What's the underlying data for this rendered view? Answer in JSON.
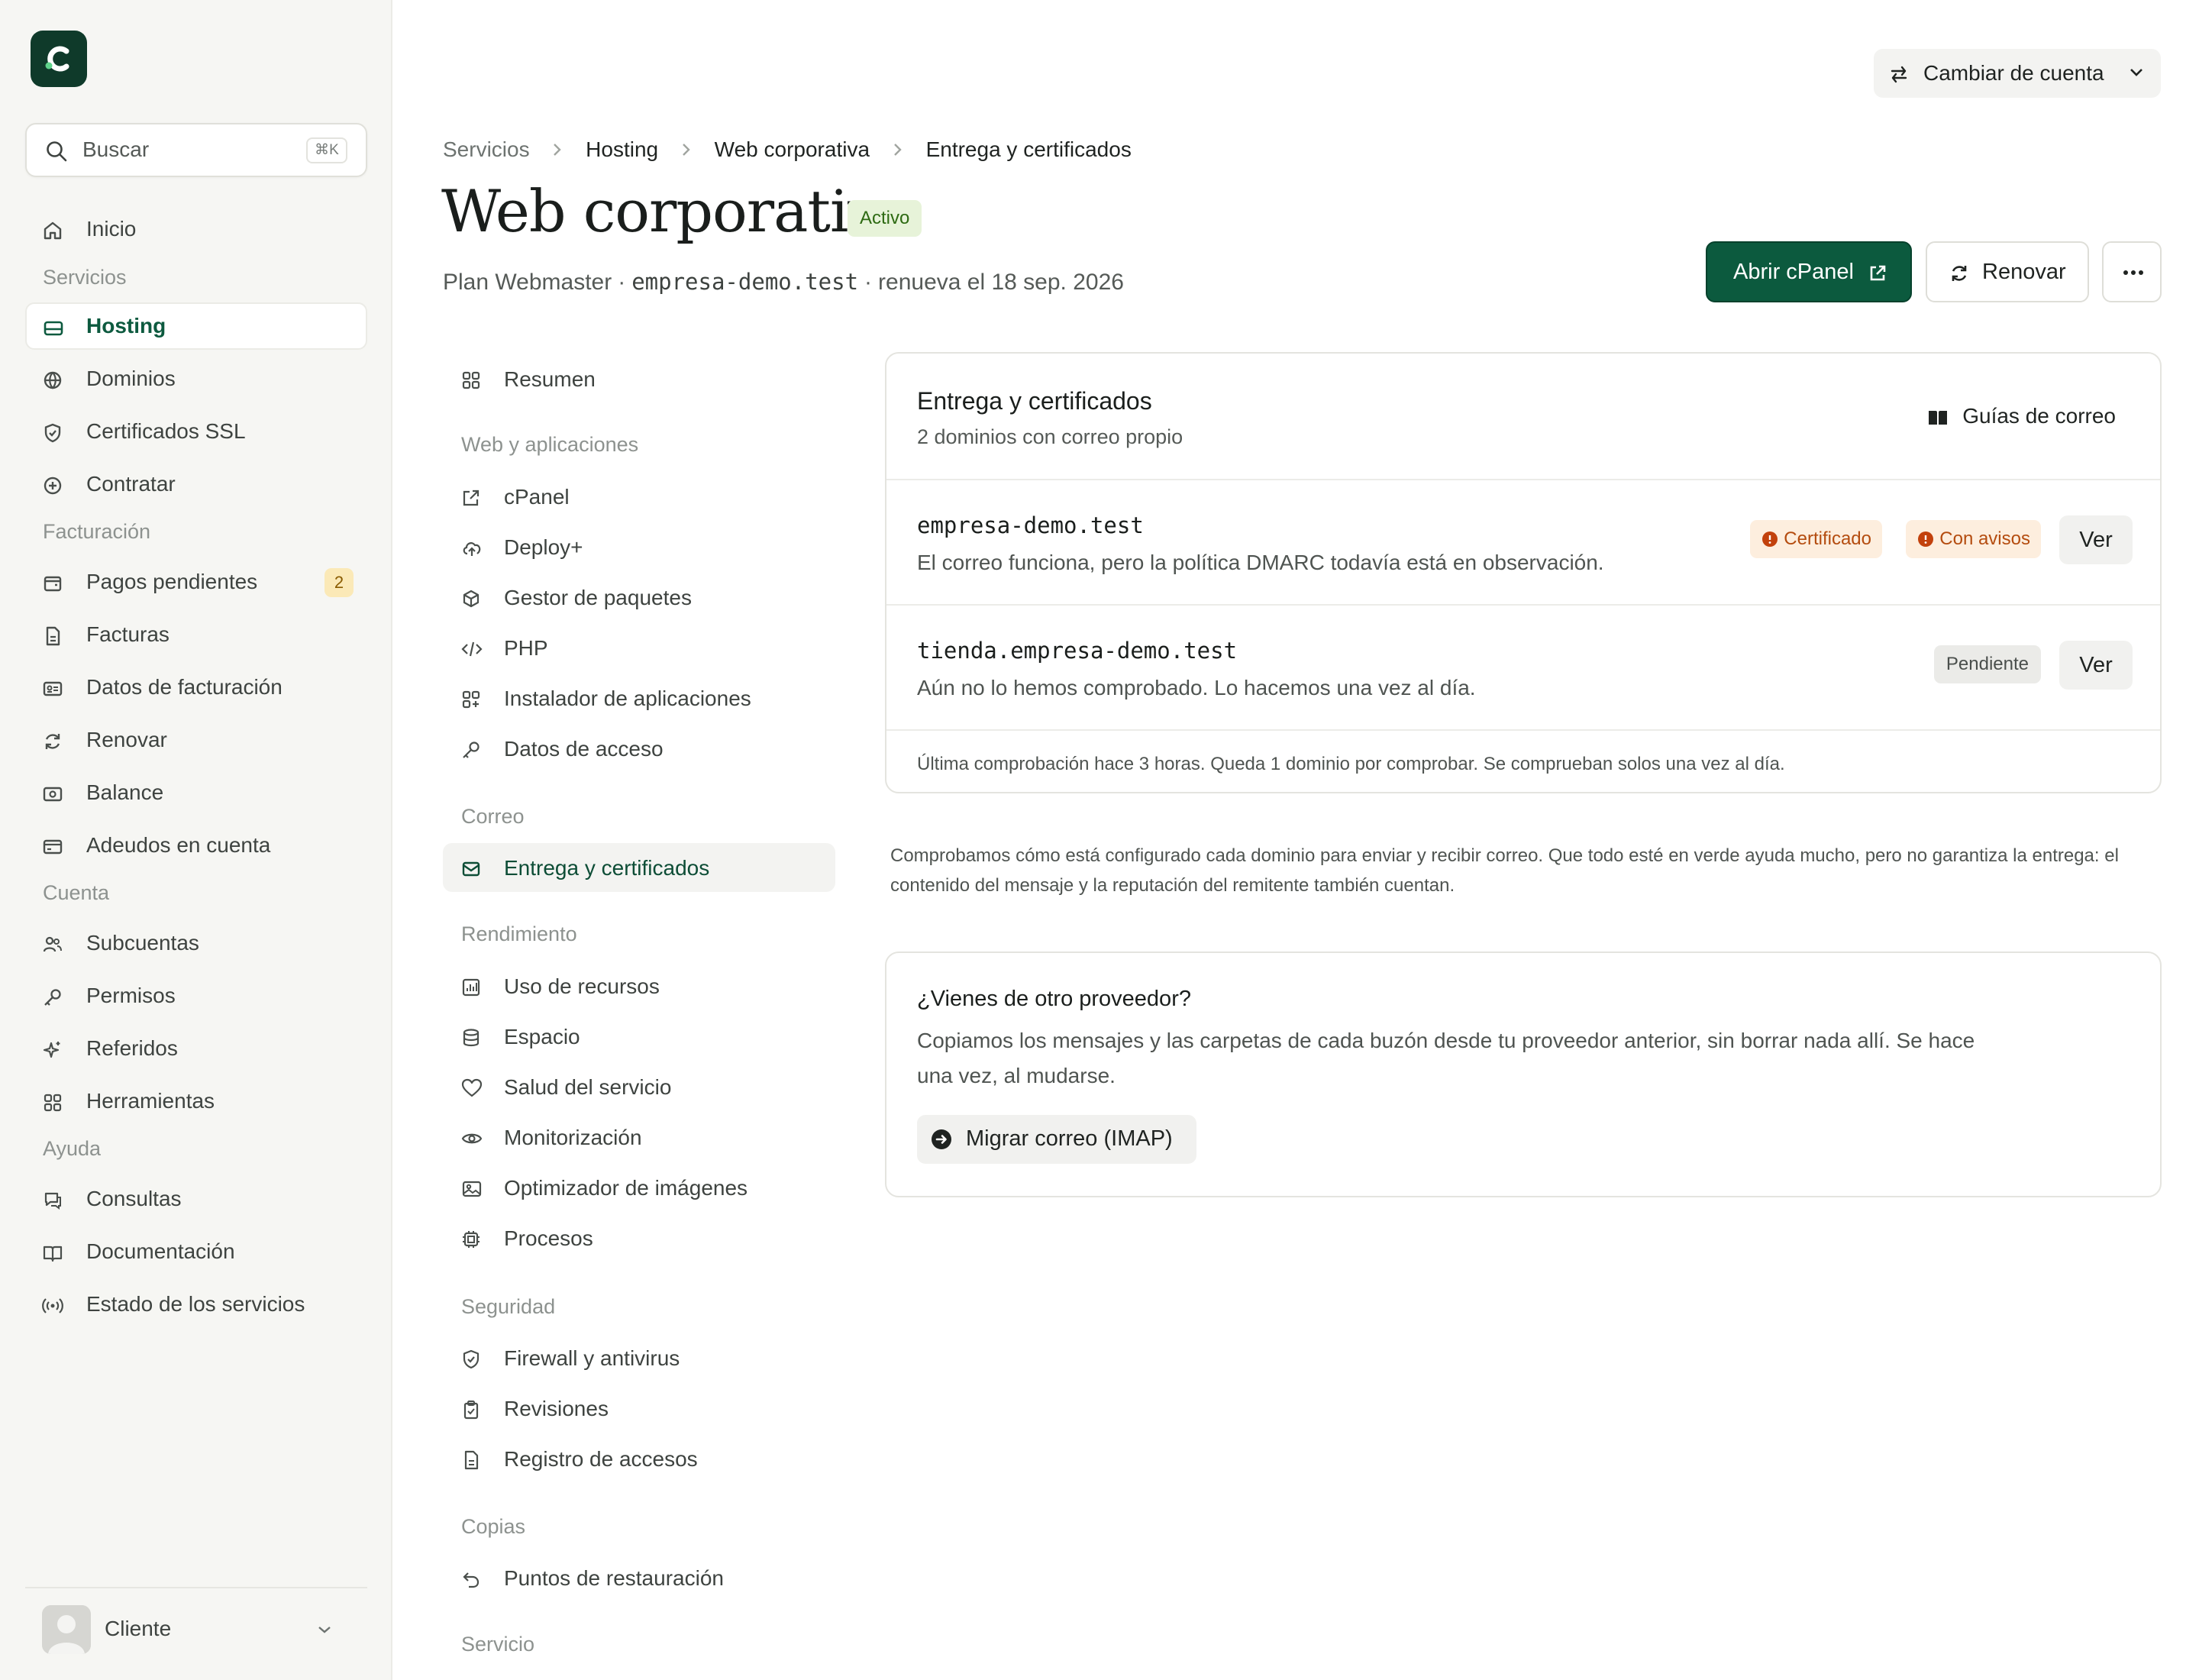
{
  "brand": {
    "logo_alt": "logo",
    "color": "#0f3a2a"
  },
  "search": {
    "label": "Buscar",
    "shortcut": "⌘K"
  },
  "sidebar": {
    "inicio": "Inicio",
    "sections": {
      "servicios": "Servicios",
      "facturacion": "Facturación",
      "cuenta": "Cuenta",
      "ayuda": "Ayuda"
    },
    "items": {
      "hosting": "Hosting",
      "dominios": "Dominios",
      "ssl": "Certificados SSL",
      "contratar": "Contratar",
      "pagos": "Pagos pendientes",
      "pagos_count": "2",
      "facturas": "Facturas",
      "datos_facturacion": "Datos de facturación",
      "renovar": "Renovar",
      "balance": "Balance",
      "adeudos": "Adeudos en cuenta",
      "subcuentas": "Subcuentas",
      "permisos": "Permisos",
      "referidos": "Referidos",
      "herramientas": "Herramientas",
      "consultas": "Consultas",
      "documentacion": "Documentación",
      "estado": "Estado de los servicios"
    },
    "user": {
      "name": "Cliente"
    }
  },
  "topbar": {
    "switch_account": "Cambiar de cuenta"
  },
  "breadcrumb": [
    "Servicios",
    "Hosting",
    "Web corporativa",
    "Entrega y certificados"
  ],
  "header": {
    "title": "Web corporativa",
    "status": "Activo",
    "plan": "Plan Webmaster",
    "domain": "empresa-demo.test",
    "renews": "renueva el 18 sep. 2026",
    "separator": "·",
    "btn_cpanel": "Abrir cPanel",
    "btn_renew": "Renovar"
  },
  "subnav": {
    "resumen": "Resumen",
    "sections": {
      "web": "Web y aplicaciones",
      "correo": "Correo",
      "rendimiento": "Rendimiento",
      "seguridad": "Seguridad",
      "copias": "Copias",
      "servicio": "Servicio"
    },
    "items": {
      "cpanel": "cPanel",
      "deploy": "Deploy+",
      "paquetes": "Gestor de paquetes",
      "php": "PHP",
      "instalador": "Instalador de aplicaciones",
      "acceso": "Datos de acceso",
      "entrega": "Entrega y certificados",
      "uso": "Uso de recursos",
      "espacio": "Espacio",
      "salud": "Salud del servicio",
      "monitorizacion": "Monitorización",
      "optimizador": "Optimizador de imágenes",
      "procesos": "Procesos",
      "firewall": "Firewall y antivirus",
      "revisiones": "Revisiones",
      "registro": "Registro de accesos",
      "restauracion": "Puntos de restauración"
    }
  },
  "delivery": {
    "title": "Entrega y certificados",
    "subtitle": "2 dominios con correo propio",
    "guides": "Guías de correo",
    "domains": [
      {
        "name": "empresa-demo.test",
        "desc": "El correo funciona, pero la política DMARC todavía está en observación.",
        "tags": [
          "Certificado",
          "Con avisos"
        ],
        "action": "Ver"
      },
      {
        "name": "tienda.empresa-demo.test",
        "desc": "Aún no lo hemos comprobado. Lo hacemos una vez al día.",
        "tags": [
          "Pendiente"
        ],
        "action": "Ver"
      }
    ],
    "footer": "Última comprobación hace 3 horas. Queda 1 dominio por comprobar. Se comprueban solos una vez al día."
  },
  "note": "Comprobamos cómo está configurado cada dominio para enviar y recibir correo. Que todo esté en verde ayuda mucho, pero no garantiza la entrega: el contenido del mensaje y la reputación del remitente también cuentan.",
  "migration": {
    "title": "¿Vienes de otro proveedor?",
    "desc": "Copiamos los mensajes y las carpetas de cada buzón desde tu proveedor anterior, sin borrar nada allí. Se hace una vez, al mudarse.",
    "button": "Migrar correo (IMAP)"
  },
  "colors": {
    "accent": "#0c5a3e",
    "warning": "#b44c0f",
    "status_active": "#2d6a12"
  }
}
